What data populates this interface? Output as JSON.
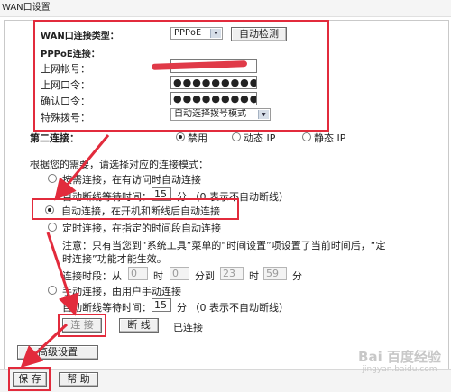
{
  "window": {
    "title": "WAN口设置"
  },
  "wan_type": {
    "label": "WAN口连接类型：",
    "value": "PPPoE",
    "auto_detect_button": "自动检测"
  },
  "pppoe": {
    "section_label": "PPPoE连接：",
    "username_label": "上网帐号：",
    "password_label": "上网口令：",
    "password_value": "●●●●●●●●●●",
    "confirm_label": "确认口令：",
    "confirm_value": "●●●●●●●●●●",
    "dial_label": "特殊拨号：",
    "dial_value": "自动选择拨号模式"
  },
  "second_connection": {
    "label": "第二连接：",
    "options": [
      "禁用",
      "动态 IP",
      "静态 IP"
    ],
    "selected": "禁用"
  },
  "mode_section": {
    "intro": "根据您的需要，请选择对应的连接模式：",
    "on_demand_label": "按需连接，在有访问时自动连接",
    "on_demand_wait_label": "自动断线等待时间：",
    "on_demand_wait_value": "15",
    "on_demand_wait_unit": "分 （0 表示不自动断线）",
    "auto_label": "自动连接，在开机和断线后自动连接",
    "scheduled_label": "定时连接，在指定的时间段自动连接",
    "note_line1": "注意：只有当您到“系统工具”菜单的“时间设置”项设置了当前时间后，“定",
    "note_line2": "时连接”功能才能生效。",
    "period_label": "连接时段：从",
    "from_hour": "0",
    "hour_text_1": "时",
    "from_minute": "0",
    "to_text": "分到",
    "to_hour": "23",
    "hour_text_2": "时",
    "to_minute": "59",
    "minute_text": "分",
    "manual_label": "手动连接，由用户手动连接",
    "manual_wait_label": "自动断线等待时间：",
    "manual_wait_value": "15",
    "manual_wait_unit": "分 （0 表示不自动断线）",
    "selected": "auto"
  },
  "actions": {
    "connect_button": "连 接",
    "disconnect_button": "断 线",
    "status_text": "已连接",
    "advanced_button": "高级设置",
    "save_button": "保 存",
    "help_button": "帮 助"
  },
  "watermark": {
    "text": "Bai 百度经验",
    "subtext": "jingyan.baidu.com"
  },
  "colors": {
    "highlight": "#e22b3c",
    "arrow": "#e22b3c"
  }
}
